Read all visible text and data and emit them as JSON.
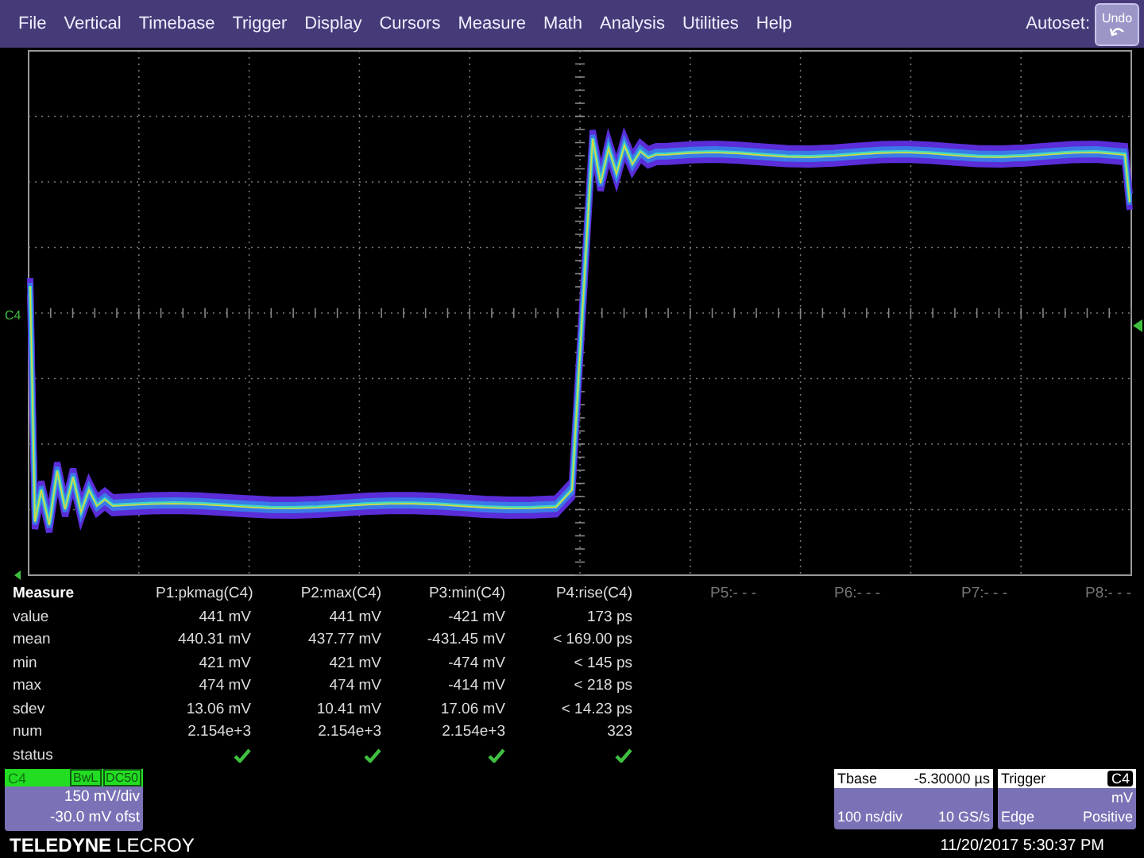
{
  "menu": {
    "items": [
      "File",
      "Vertical",
      "Timebase",
      "Trigger",
      "Display",
      "Cursors",
      "Measure",
      "Math",
      "Analysis",
      "Utilities",
      "Help"
    ],
    "autoset": "Autoset:",
    "undo": "Undo"
  },
  "graticule": {
    "channel_label": "C4"
  },
  "measure": {
    "title": "Measure",
    "row_labels": [
      "value",
      "mean",
      "min",
      "max",
      "sdev",
      "num",
      "status"
    ],
    "params": [
      {
        "name": "P1:pkmag(C4)",
        "values": [
          "441 mV",
          "440.31 mV",
          "421 mV",
          "474 mV",
          "13.06 mV",
          "2.154e+3"
        ],
        "status_ok": true
      },
      {
        "name": "P2:max(C4)",
        "values": [
          "441 mV",
          "437.77 mV",
          "421 mV",
          "474 mV",
          "10.41 mV",
          "2.154e+3"
        ],
        "status_ok": true
      },
      {
        "name": "P3:min(C4)",
        "values": [
          "-421 mV",
          "-431.45 mV",
          "-474 mV",
          "-414 mV",
          "17.06 mV",
          "2.154e+3"
        ],
        "status_ok": true
      },
      {
        "name": "P4:rise(C4)",
        "values": [
          "173 ps",
          "< 169.00 ps",
          "< 145 ps",
          "< 218 ps",
          "< 14.23 ps",
          "323"
        ],
        "status_ok": true
      }
    ],
    "empty_params": [
      "P5:- - -",
      "P6:- - -",
      "P7:- - -",
      "P8:- - -"
    ]
  },
  "channel_box": {
    "label": "C4",
    "tags": [
      "BwL",
      "DC50"
    ],
    "scale": "150 mV/div",
    "offset": "-30.0 mV ofst"
  },
  "brand": {
    "bold": "TELEDYNE",
    "light": "LECROY"
  },
  "timebase_box": {
    "title": "Tbase",
    "value": "-5.30000 µs",
    "row2": [
      "100 ns/div",
      "10 GS/s"
    ]
  },
  "trigger_box": {
    "title": "Trigger",
    "source": "C4",
    "row2": "mV",
    "row3": [
      "Edge",
      "Positive"
    ]
  },
  "timestamp": "11/20/2017 5:30:37 PM"
}
